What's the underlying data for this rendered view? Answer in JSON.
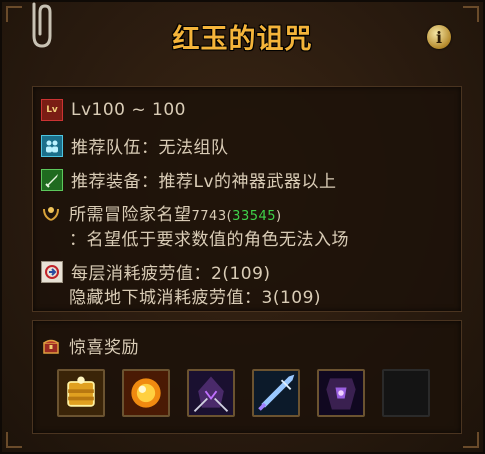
{
  "window": {
    "title": "红玉的诅咒",
    "info_label": "i"
  },
  "info": {
    "level_label": "Lv100 ~ 100",
    "level_icon_text": "Lv",
    "team": "推荐队伍：无法组队",
    "equipment": "推荐装备：推荐Lv的神器武器以上",
    "reputation_prefix": "所需冒险家名望",
    "reputation_current": "7743",
    "reputation_open": "(",
    "reputation_required": "33545",
    "reputation_close": ")",
    "reputation_note": "：名望低于要求数值的角色无法入场",
    "fatigue_per_floor": "每层消耗疲劳值：2(109)",
    "fatigue_hidden": "隐藏地下城消耗疲劳值：3(109)"
  },
  "reward": {
    "title": "惊喜奖励",
    "items": [
      {
        "name": "gold-cube-icon"
      },
      {
        "name": "golden-orb-icon"
      },
      {
        "name": "dark-hooded-icon"
      },
      {
        "name": "crystal-blade-icon"
      },
      {
        "name": "shadow-armor-icon"
      },
      {
        "name": "empty-slot"
      }
    ]
  },
  "colors": {
    "title": "#f4b43a",
    "text": "#d9ccb6",
    "highlight": "#3fd24a"
  }
}
